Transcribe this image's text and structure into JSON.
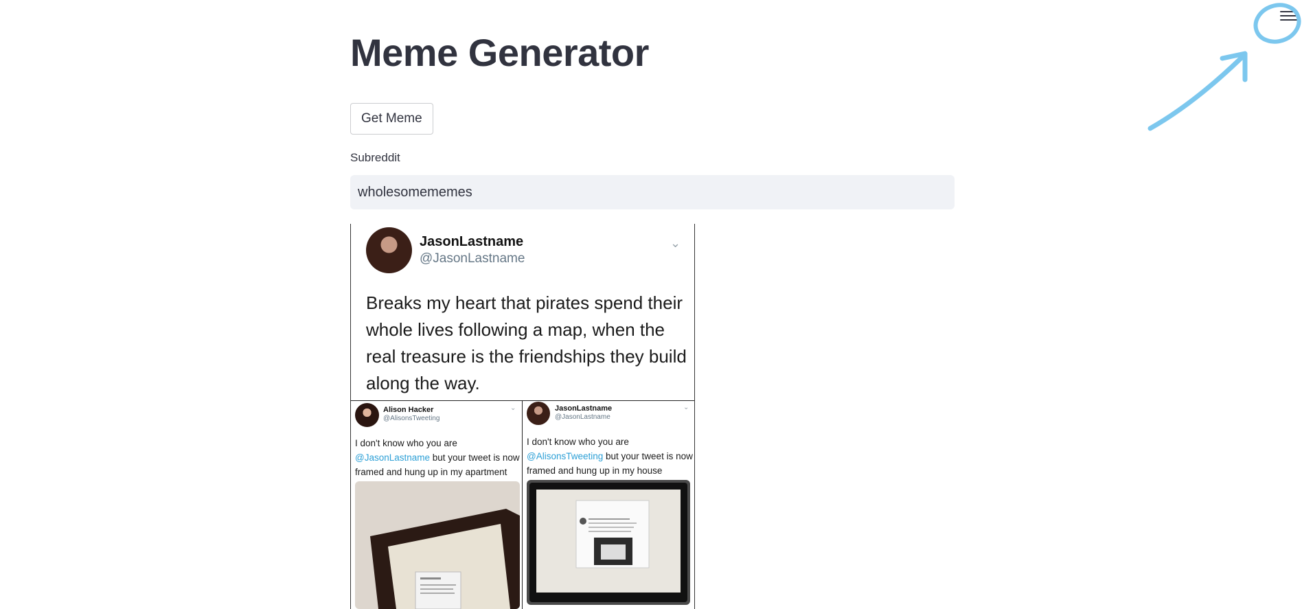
{
  "app": {
    "title": "Meme Generator",
    "get_meme_label": "Get Meme",
    "subreddit_label": "Subreddit",
    "subreddit_value": "wholesomememes",
    "menu_icon": "hamburger-menu-icon",
    "annotation_color": "#7cc7ee"
  },
  "meme": {
    "top": {
      "name": "JasonLastname",
      "handle": "@JasonLastname",
      "lines": [
        "Breaks my heart that pirates spend their",
        "whole lives following a map, when the",
        "real treasure is the friendships they build",
        "along the way."
      ]
    },
    "left": {
      "name": "Alison Hacker",
      "handle": "@AlisonsTweeting",
      "line1": "I don't know who you are",
      "mention": "@JasonLastname",
      "line2_rest": " but your tweet is now",
      "line3": "framed and hung up in my apartment"
    },
    "right": {
      "name": "JasonLastname",
      "handle": "@JasonLastname",
      "line1": "I don't know who you are",
      "mention": "@AlisonsTweeting",
      "line2_rest": " but your tweet is now",
      "line3": "framed and hung up in my house"
    }
  }
}
